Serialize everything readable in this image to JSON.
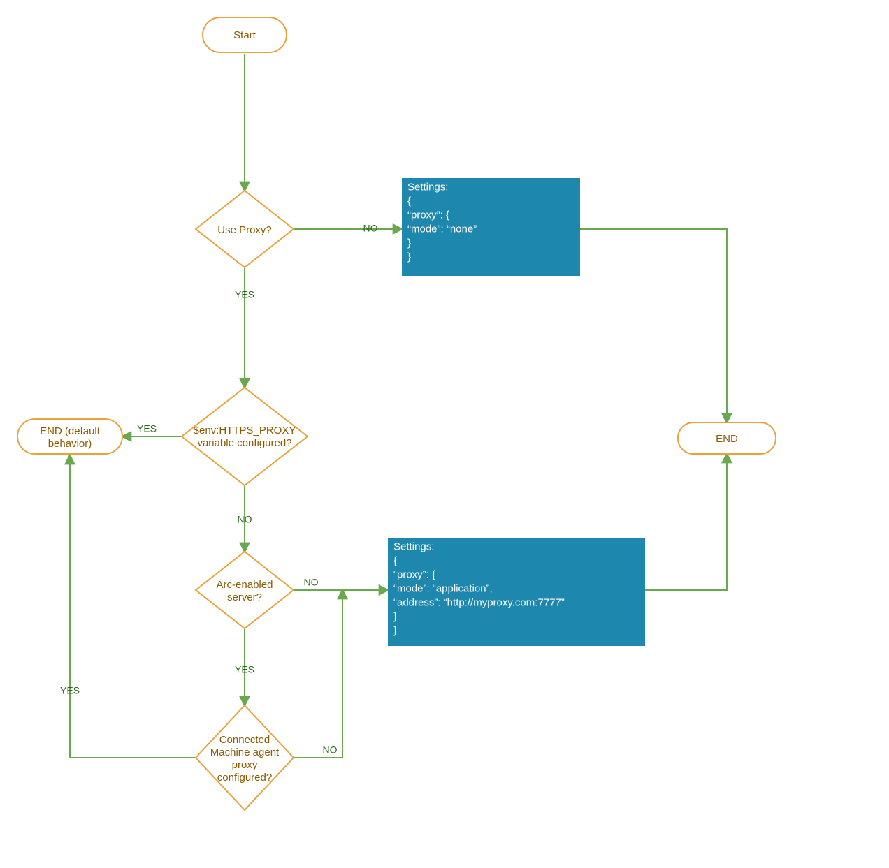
{
  "colors": {
    "node_stroke": "#e8a33d",
    "node_text": "#8a5a00",
    "process_fill": "#1e87ad",
    "process_text": "#ffffff",
    "edge": "#6aa84f",
    "edge_label": "#2b6b1f"
  },
  "nodes": {
    "start": {
      "label": "Start"
    },
    "use_proxy": {
      "label": "Use Proxy?"
    },
    "https_proxy": {
      "line1": "$env:HTTPS_PROXY",
      "line2": "variable configured?"
    },
    "arc_enabled": {
      "line1": "Arc-enabled",
      "line2": "server?"
    },
    "cmap": {
      "line1": "Connected",
      "line2": "Machine agent",
      "line3": "proxy",
      "line4": "configured?"
    },
    "end_default": {
      "line1": "END (default",
      "line2": "behavior)"
    },
    "end": {
      "label": "END"
    },
    "settings_none": {
      "l1": "Settings:",
      "l2": "{",
      "l3": "  “proxy”: {",
      "l4": "        “mode”: “none”",
      "l5": "  }",
      "l6": "}"
    },
    "settings_app": {
      "l1": "Settings:",
      "l2": "{",
      "l3": "  “proxy”: {",
      "l4": "        “mode”: “application”,",
      "l5": "        “address”: “http://myproxy.com:7777”",
      "l6": "  }",
      "l7": "}"
    }
  },
  "edge_labels": {
    "use_proxy_no": "NO",
    "use_proxy_yes": "YES",
    "https_proxy_yes": "YES",
    "https_proxy_no": "NO",
    "arc_enabled_no": "NO",
    "arc_enabled_yes": "YES",
    "cmap_no": "NO",
    "cmap_yes": "YES"
  },
  "chart_data": {
    "type": "flowchart",
    "nodes": [
      {
        "id": "start",
        "type": "terminator",
        "label": "Start"
      },
      {
        "id": "use_proxy",
        "type": "decision",
        "label": "Use Proxy?"
      },
      {
        "id": "settings_none",
        "type": "process",
        "label": "Settings: { \"proxy\": { \"mode\": \"none\" } }"
      },
      {
        "id": "https_proxy",
        "type": "decision",
        "label": "$env:HTTPS_PROXY variable configured?"
      },
      {
        "id": "end_default",
        "type": "terminator",
        "label": "END (default behavior)"
      },
      {
        "id": "arc_enabled",
        "type": "decision",
        "label": "Arc-enabled server?"
      },
      {
        "id": "settings_app",
        "type": "process",
        "label": "Settings: { \"proxy\": { \"mode\": \"application\", \"address\": \"http://myproxy.com:7777\" } }"
      },
      {
        "id": "cmap",
        "type": "decision",
        "label": "Connected Machine agent proxy configured?"
      },
      {
        "id": "end",
        "type": "terminator",
        "label": "END"
      }
    ],
    "edges": [
      {
        "from": "start",
        "to": "use_proxy"
      },
      {
        "from": "use_proxy",
        "to": "settings_none",
        "label": "NO"
      },
      {
        "from": "use_proxy",
        "to": "https_proxy",
        "label": "YES"
      },
      {
        "from": "settings_none",
        "to": "end"
      },
      {
        "from": "https_proxy",
        "to": "end_default",
        "label": "YES"
      },
      {
        "from": "https_proxy",
        "to": "arc_enabled",
        "label": "NO"
      },
      {
        "from": "arc_enabled",
        "to": "settings_app",
        "label": "NO"
      },
      {
        "from": "arc_enabled",
        "to": "cmap",
        "label": "YES"
      },
      {
        "from": "settings_app",
        "to": "end"
      },
      {
        "from": "cmap",
        "to": "settings_app",
        "label": "NO"
      },
      {
        "from": "cmap",
        "to": "end_default",
        "label": "YES"
      }
    ]
  }
}
